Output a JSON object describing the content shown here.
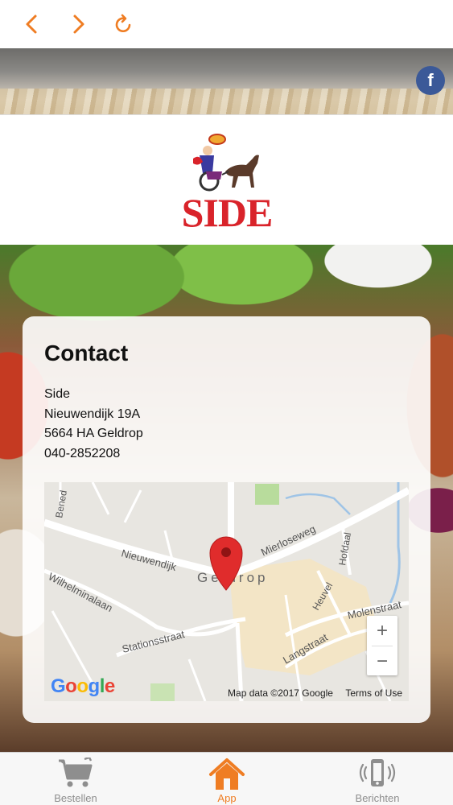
{
  "app": {
    "accent_color": "#ef7d23"
  },
  "toolbar": {
    "back_icon": "chevron-left-icon",
    "forward_icon": "chevron-right-icon",
    "reload_icon": "reload-icon"
  },
  "social": {
    "facebook_icon": "facebook-icon",
    "facebook_glyph": "f"
  },
  "logo": {
    "text": "SIDE",
    "brand_color": "#d9232a"
  },
  "contact": {
    "title": "Contact",
    "name": "Side",
    "street": "Nieuwendijk 19A",
    "city": "5664 HA Geldrop",
    "phone": "040-2852208"
  },
  "map": {
    "place_label": "Geldrop",
    "streets": [
      "Nieuwendijk",
      "Wilhelminalaan",
      "Stationsstraat",
      "Mierloseweg",
      "Hofdaal",
      "Heuvel",
      "Molenstraat",
      "Langstraat",
      "Bened"
    ],
    "zoom_in": "+",
    "zoom_out": "−",
    "google_letters": [
      "G",
      "o",
      "o",
      "g",
      "l",
      "e"
    ],
    "attribution": "Map data ©2017 Google",
    "terms": "Terms of Use"
  },
  "tabs": [
    {
      "label": "Bestellen",
      "icon": "cart-icon",
      "active": false
    },
    {
      "label": "App",
      "icon": "home-icon",
      "active": true
    },
    {
      "label": "Berichten",
      "icon": "phone-message-icon",
      "active": false
    }
  ]
}
